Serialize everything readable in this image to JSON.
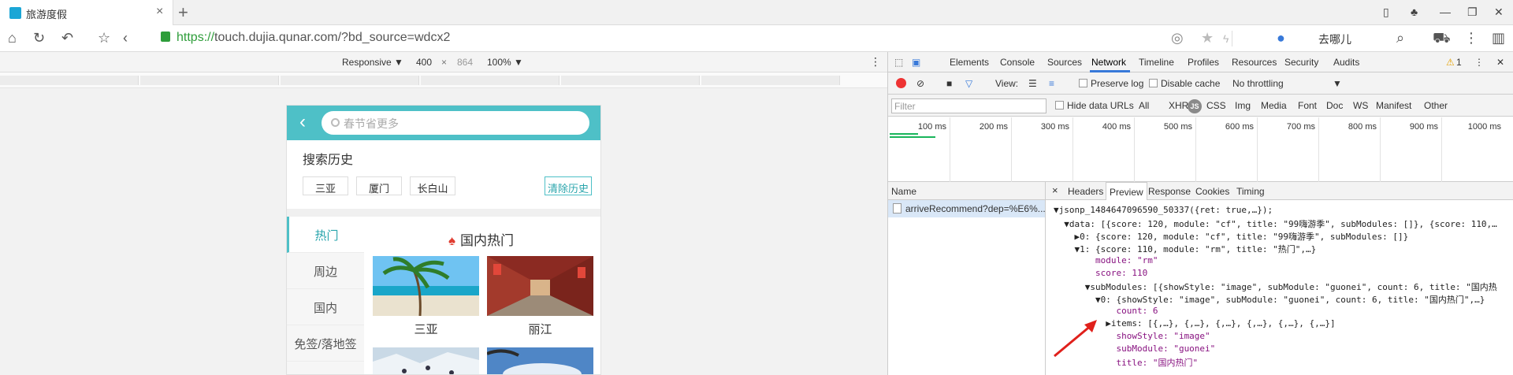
{
  "browser": {
    "tab_title": "旅游度假",
    "tab_close": "×",
    "new_tab": "+",
    "url_scheme": "https://",
    "url_rest": "touch.dujia.qunar.com/?bd_source=wdcx2",
    "search_placeholder": "去哪儿"
  },
  "device_toolbar": {
    "mode": "Responsive ▼",
    "width": "400",
    "times": "×",
    "height": "864",
    "zoom": "100% ▼"
  },
  "mobile": {
    "search_placeholder": "春节省更多",
    "history_title": "搜索历史",
    "history_chips": [
      "三亚",
      "厦门",
      "长白山"
    ],
    "clear_history": "清除历史",
    "side_items": [
      "热门",
      "周边",
      "国内",
      "免签/落地签"
    ],
    "section_title": "国内热门",
    "cards": [
      {
        "label": "三亚"
      },
      {
        "label": "丽江"
      }
    ]
  },
  "devtools": {
    "tabs": [
      "Elements",
      "Console",
      "Sources",
      "Network",
      "Timeline",
      "Profiles",
      "Resources",
      "Security",
      "Audits"
    ],
    "active_tab": "Network",
    "warning_count": "1",
    "view_label": "View:",
    "preserve_log": "Preserve log",
    "disable_cache": "Disable cache",
    "throttling": "No throttling",
    "filter_placeholder": "Filter",
    "hide_data_urls": "Hide data URLs",
    "type_filters": [
      "All",
      "XHR",
      "JS",
      "CSS",
      "Img",
      "Media",
      "Font",
      "Doc",
      "WS",
      "Manifest",
      "Other"
    ],
    "timeline_labels": [
      "100 ms",
      "200 ms",
      "300 ms",
      "400 ms",
      "500 ms",
      "600 ms",
      "700 ms",
      "800 ms",
      "900 ms",
      "1000 ms"
    ],
    "name_header": "Name",
    "request_name": "arriveRecommend?dep=%E6%...",
    "detail_close": "×",
    "detail_tabs": [
      "Headers",
      "Preview",
      "Response",
      "Cookies",
      "Timing"
    ],
    "detail_active": "Preview",
    "preview_lines": [
      "▼jsonp_1484647096590_50337({ret: true,…});",
      "  ▼data: [{score: 120, module: \"cf\", title: \"99嗨游季\", subModules: []}, {score: 110,…",
      "    ▶0: {score: 120, module: \"cf\", title: \"99嗨游季\", subModules: []}",
      "    ▼1: {score: 110, module: \"rm\", title: \"热门\",…}",
      "        module: \"rm\"",
      "        score: 110",
      "      ▼subModules: [{showStyle: \"image\", subModule: \"guonei\", count: 6, title: \"国内热",
      "        ▼0: {showStyle: \"image\", subModule: \"guonei\", count: 6, title: \"国内热门\",…}",
      "            count: 6",
      "          ▶items: [{,…}, {,…}, {,…}, {,…}, {,…}, {,…}]",
      "            showStyle: \"image\"",
      "            subModule: \"guonei\"",
      "            title: \"国内热门\""
    ]
  },
  "colors": {
    "header_teal": "#4ec0c7",
    "accent_blue": "#3879d9",
    "annotation_red": "#e0201b"
  }
}
